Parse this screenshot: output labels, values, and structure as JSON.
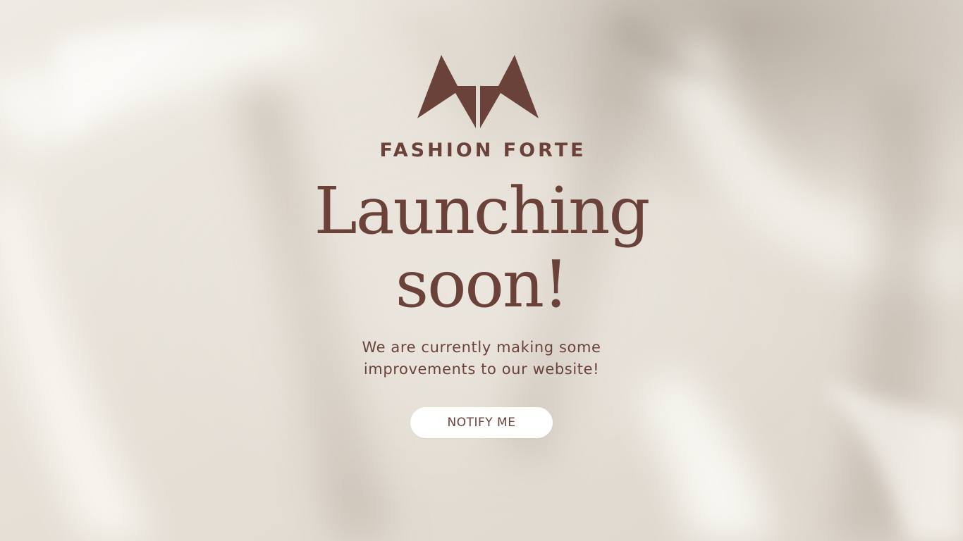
{
  "page": {
    "brand_name": "FASHION FORTE",
    "headline_line1": "Launching",
    "headline_line2": "soon!",
    "subtext_line1": "We are currently making some",
    "subtext_line2": "improvements to our website!",
    "notify_button_label": "NOTIFY ME"
  },
  "logo": {
    "icon": "fashion-forte-m-mark",
    "color": "#6b423a"
  },
  "colors": {
    "accent": "#6b423a",
    "button_background": "#ffffff",
    "background": "#ece7df"
  },
  "background": {
    "description_icon": "silk-fabric-background"
  }
}
